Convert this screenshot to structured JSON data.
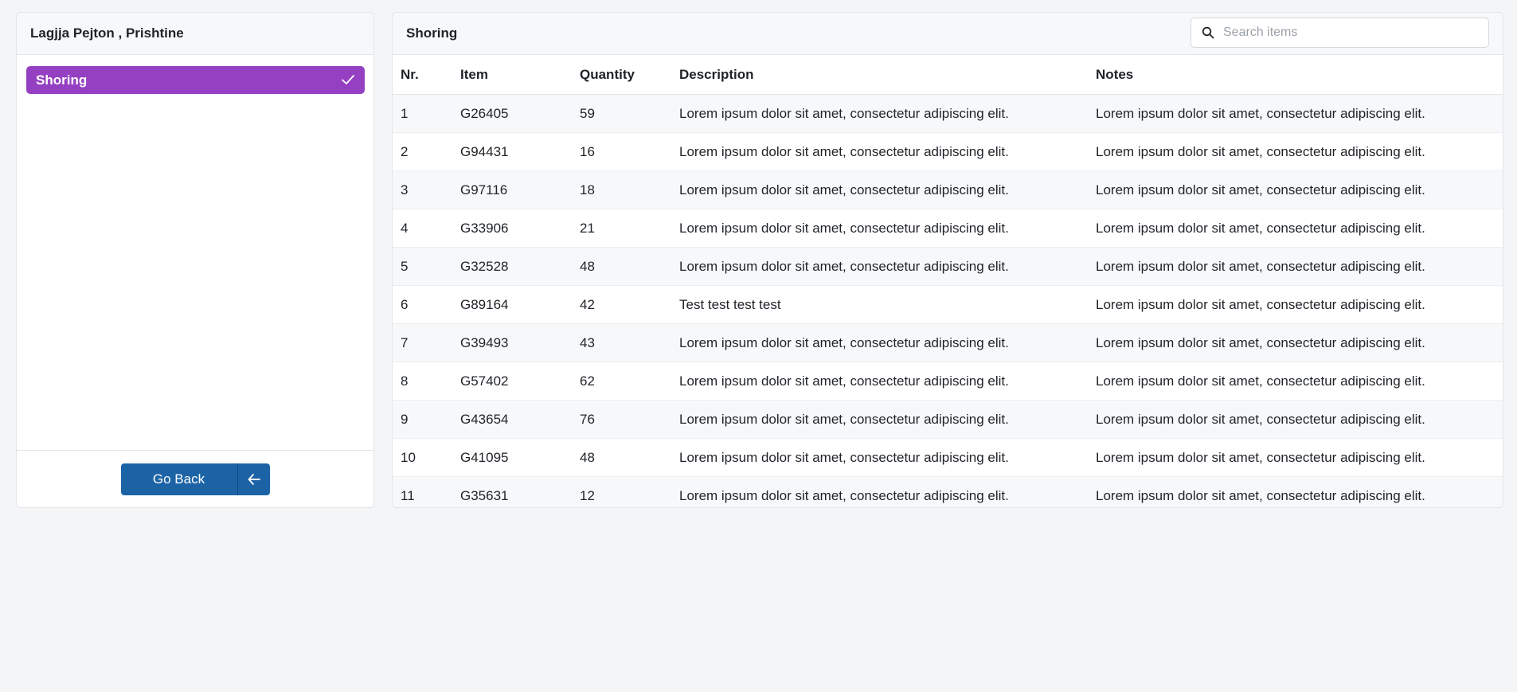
{
  "sidebar": {
    "title": "Lagjja Pejton , Prishtine",
    "categories": [
      {
        "label": "Shoring",
        "selected": true
      }
    ],
    "go_back_label": "Go Back"
  },
  "main": {
    "title": "Shoring",
    "search": {
      "placeholder": "Search items",
      "value": ""
    },
    "columns": [
      "Nr.",
      "Item",
      "Quantity",
      "Description",
      "Notes"
    ],
    "rows": [
      {
        "nr": "1",
        "item": "G26405",
        "quantity": "59",
        "description": "Lorem ipsum dolor sit amet, consectetur adipiscing elit.",
        "notes": "Lorem ipsum dolor sit amet, consectetur adipiscing elit."
      },
      {
        "nr": "2",
        "item": "G94431",
        "quantity": "16",
        "description": "Lorem ipsum dolor sit amet, consectetur adipiscing elit.",
        "notes": "Lorem ipsum dolor sit amet, consectetur adipiscing elit."
      },
      {
        "nr": "3",
        "item": "G97116",
        "quantity": "18",
        "description": "Lorem ipsum dolor sit amet, consectetur adipiscing elit.",
        "notes": "Lorem ipsum dolor sit amet, consectetur adipiscing elit."
      },
      {
        "nr": "4",
        "item": "G33906",
        "quantity": "21",
        "description": "Lorem ipsum dolor sit amet, consectetur adipiscing elit.",
        "notes": "Lorem ipsum dolor sit amet, consectetur adipiscing elit."
      },
      {
        "nr": "5",
        "item": "G32528",
        "quantity": "48",
        "description": "Lorem ipsum dolor sit amet, consectetur adipiscing elit.",
        "notes": "Lorem ipsum dolor sit amet, consectetur adipiscing elit."
      },
      {
        "nr": "6",
        "item": "G89164",
        "quantity": "42",
        "description": "Test test test test",
        "notes": "Lorem ipsum dolor sit amet, consectetur adipiscing elit."
      },
      {
        "nr": "7",
        "item": "G39493",
        "quantity": "43",
        "description": "Lorem ipsum dolor sit amet, consectetur adipiscing elit.",
        "notes": "Lorem ipsum dolor sit amet, consectetur adipiscing elit."
      },
      {
        "nr": "8",
        "item": "G57402",
        "quantity": "62",
        "description": "Lorem ipsum dolor sit amet, consectetur adipiscing elit.",
        "notes": "Lorem ipsum dolor sit amet, consectetur adipiscing elit."
      },
      {
        "nr": "9",
        "item": "G43654",
        "quantity": "76",
        "description": "Lorem ipsum dolor sit amet, consectetur adipiscing elit.",
        "notes": "Lorem ipsum dolor sit amet, consectetur adipiscing elit."
      },
      {
        "nr": "10",
        "item": "G41095",
        "quantity": "48",
        "description": "Lorem ipsum dolor sit amet, consectetur adipiscing elit.",
        "notes": "Lorem ipsum dolor sit amet, consectetur adipiscing elit."
      },
      {
        "nr": "11",
        "item": "G35631",
        "quantity": "12",
        "description": "Lorem ipsum dolor sit amet, consectetur adipiscing elit.",
        "notes": "Lorem ipsum dolor sit amet, consectetur adipiscing elit."
      }
    ]
  },
  "colors": {
    "selected_category": "#9540c2",
    "go_back_button": "#1c63a6",
    "page_background": "#f4f5f7"
  },
  "icons": {
    "category_selected": "check-icon",
    "go_back": "arrow-left-icon",
    "search": "search-icon"
  }
}
